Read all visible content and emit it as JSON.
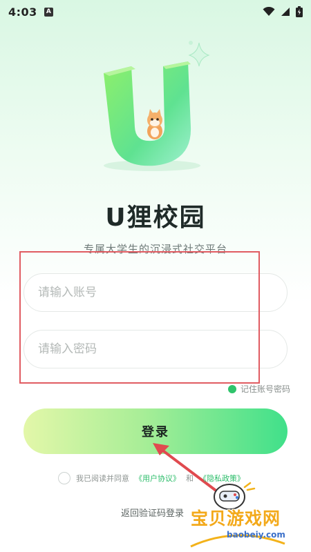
{
  "status_bar": {
    "time": "4:03",
    "notification_icon": "A"
  },
  "app": {
    "title": "U狸校园",
    "subtitle": "专属大学生的沉浸式社交平台"
  },
  "form": {
    "account_placeholder": "请输入账号",
    "password_placeholder": "请输入密码",
    "remember_label": "记住账号密码",
    "login_label": "登录"
  },
  "agreement": {
    "prefix": "我已阅读并同意",
    "user_agreement": "《用户协议》",
    "and": "和",
    "privacy_policy": "《隐私政策》"
  },
  "sms_login_label": "返回验证码登录",
  "watermark": {
    "text": "宝贝游戏网",
    "url": "baobeiy.com"
  },
  "colors": {
    "accent_green": "#2fc46b",
    "highlight_red": "#e05b61",
    "button_gradient_start": "#e3f7a9",
    "button_gradient_end": "#40e08a"
  },
  "icons": {
    "status_notification": "a-badge-icon",
    "wifi": "wifi-icon",
    "signal": "cell-signal-icon",
    "battery": "battery-icon",
    "logo": "u-logo-with-cat-icon",
    "sparkle": "sparkle-icon",
    "arrow": "red-arrow-icon",
    "watermark_mascot": "gamepad-mascot-icon"
  }
}
